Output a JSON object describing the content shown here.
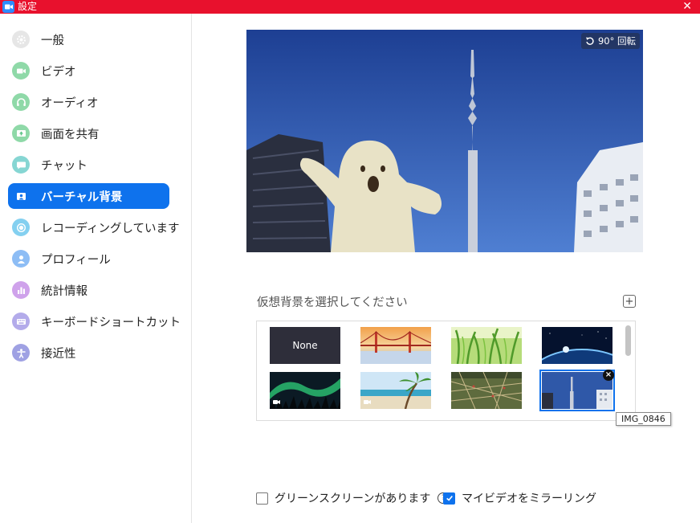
{
  "window": {
    "title": "設定",
    "close_glyph": "✕"
  },
  "sidebar": {
    "items": [
      {
        "label": "一般",
        "icon": "gear-icon",
        "color": "#8f8f8f"
      },
      {
        "label": "ビデオ",
        "icon": "video-camera-icon",
        "color": "#3cb67a"
      },
      {
        "label": "オーディオ",
        "icon": "headphones-icon",
        "color": "#3cb67a"
      },
      {
        "label": "画面を共有",
        "icon": "share-screen-icon",
        "color": "#3cb67a"
      },
      {
        "label": "チャット",
        "icon": "chat-bubble-icon",
        "color": "#2cb7b3"
      },
      {
        "label": "バーチャル背景",
        "icon": "virtual-background-icon",
        "color": "#0e72ed",
        "active": true
      },
      {
        "label": "レコーディングしています",
        "icon": "record-icon",
        "color": "#2ab0e8"
      },
      {
        "label": "プロフィール",
        "icon": "profile-icon",
        "color": "#3e8ff0"
      },
      {
        "label": "統計情報",
        "icon": "statistics-icon",
        "color": "#b06ad8"
      },
      {
        "label": "キーボードショートカット",
        "icon": "keyboard-icon",
        "color": "#8075d8"
      },
      {
        "label": "接近性",
        "icon": "accessibility-icon",
        "color": "#7c7fd6"
      }
    ]
  },
  "preview": {
    "rotate_label": "90° 回転"
  },
  "backgrounds": {
    "section_title": "仮想背景を選択してください",
    "add_glyph": "+",
    "none_label": "None",
    "items": [
      "None",
      "Golden Gate Bridge",
      "Grass",
      "Earth from space",
      "Aurora",
      "Beach",
      "Map",
      "IMG_0846"
    ],
    "selected_tooltip": "IMG_0846",
    "remove_glyph": "×"
  },
  "options": {
    "green_screen_label": "グリーンスクリーンがあります",
    "green_screen_checked": false,
    "help_glyph": "?",
    "mirror_label": "マイビデオをミラーリング",
    "mirror_checked": true
  },
  "colors": {
    "titlebar": "#e8112d",
    "accent": "#0e72ed"
  }
}
